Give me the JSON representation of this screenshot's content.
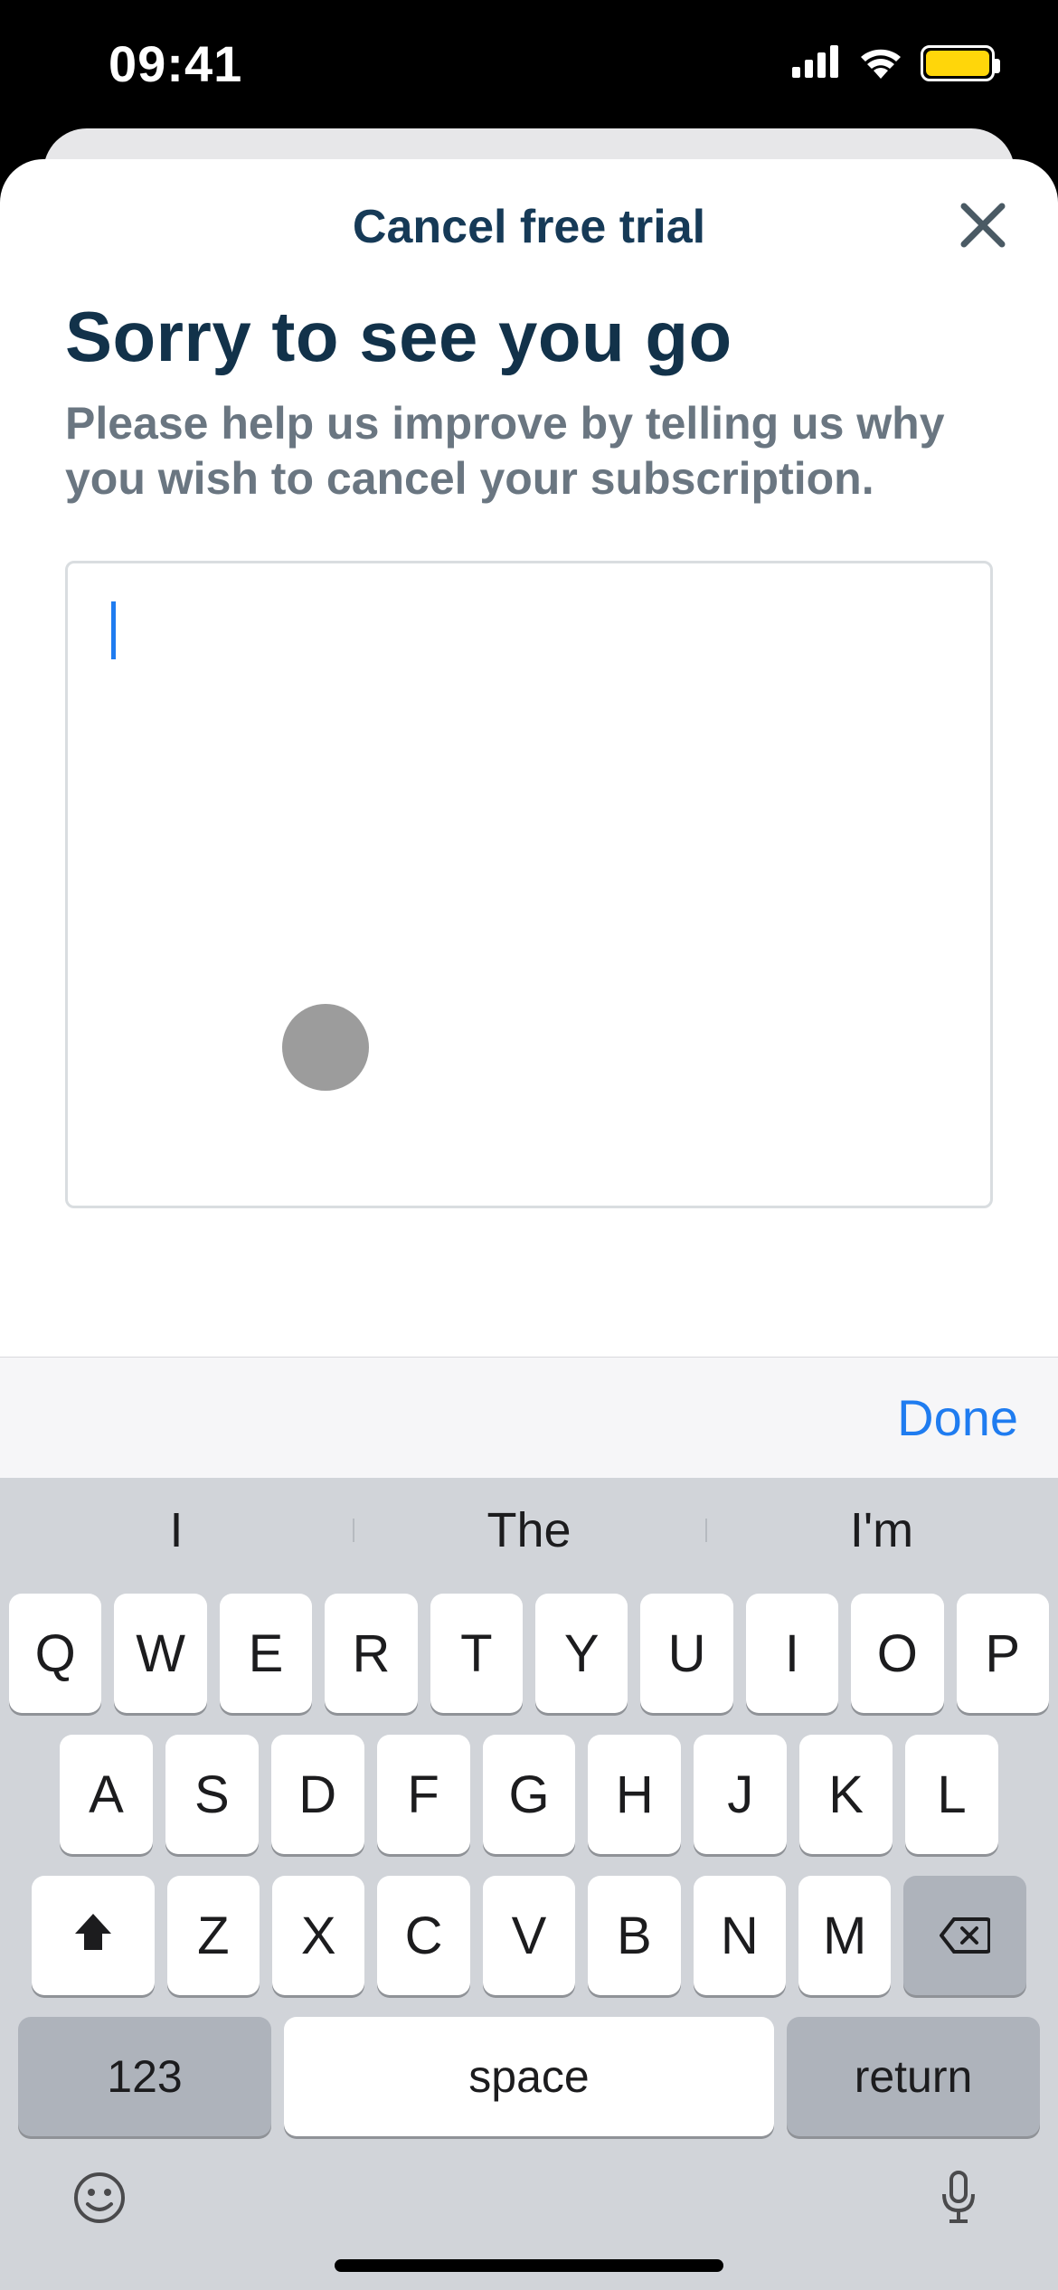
{
  "status": {
    "time": "09:41"
  },
  "modal": {
    "title": "Cancel free trial",
    "heading": "Sorry to see you go",
    "subtext": "Please help us improve by telling us why you wish to cancel your subscription.",
    "textarea_value": ""
  },
  "keyboard": {
    "done_label": "Done",
    "suggestions": [
      "I",
      "The",
      "I'm"
    ],
    "row1": [
      "Q",
      "W",
      "E",
      "R",
      "T",
      "Y",
      "U",
      "I",
      "O",
      "P"
    ],
    "row2": [
      "A",
      "S",
      "D",
      "F",
      "G",
      "H",
      "J",
      "K",
      "L"
    ],
    "row3": [
      "Z",
      "X",
      "C",
      "V",
      "B",
      "N",
      "M"
    ],
    "numbers_label": "123",
    "space_label": "space",
    "return_label": "return"
  }
}
